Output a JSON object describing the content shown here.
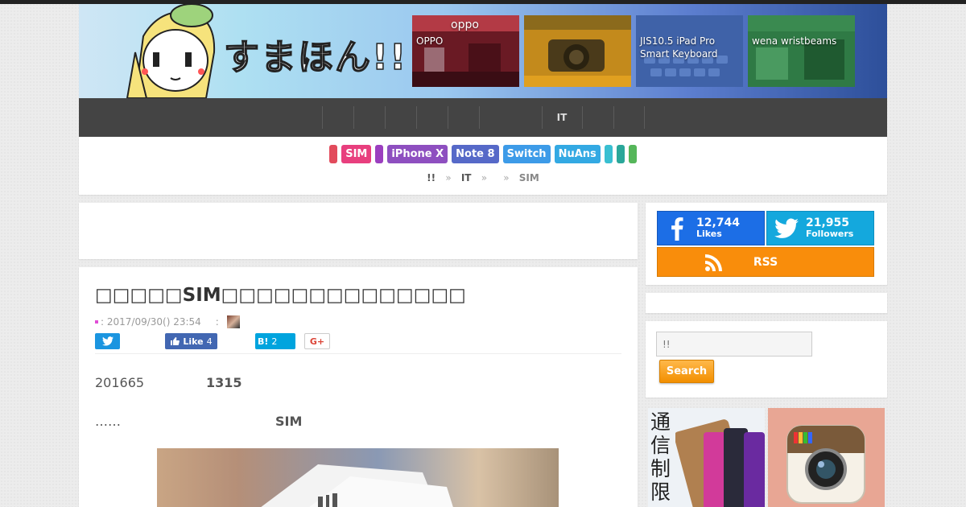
{
  "header": {
    "logo_text": "すまほん!!",
    "thumbnails": [
      {
        "label": "OPPO"
      },
      {
        "label": ""
      },
      {
        "label": "JIS10.5 iPad Pro Smart Keyboard"
      },
      {
        "label": "wena wristbeams"
      }
    ]
  },
  "nav": {
    "items": [
      "",
      "",
      "",
      "",
      "",
      "",
      "IT",
      "",
      ""
    ]
  },
  "tags": {
    "items": [
      {
        "label": "",
        "color": "#e24b5c"
      },
      {
        "label": "SIM",
        "color": "#e83f7e"
      },
      {
        "label": "",
        "color": "#9b3fbf"
      },
      {
        "label": "iPhone X",
        "color": "#8e4fc0"
      },
      {
        "label": "Note 8",
        "color": "#5669c8"
      },
      {
        "label": "Switch",
        "color": "#3d9be8"
      },
      {
        "label": "NuAns",
        "color": "#33a9e3"
      },
      {
        "label": "",
        "color": "#39bfd1"
      },
      {
        "label": "",
        "color": "#2aa79a"
      },
      {
        "label": "",
        "color": "#55b65a"
      }
    ]
  },
  "breadcrumb": {
    "home": "!!",
    "sep": "»",
    "it": "IT",
    "sim": "SIM"
  },
  "article": {
    "title": "SIM",
    "date": ": 2017/09/30() 23:54",
    "author_colon": ":",
    "share": {
      "facebook_like": "Like",
      "facebook_count": "4",
      "hatena_label": "B!",
      "hatena_count": "2",
      "google_label": "G+"
    },
    "para1_start": "201665",
    "para1_num": "1315",
    "para2_start": "……",
    "para2_sim": "SIM"
  },
  "sidebar": {
    "facebook": {
      "count": "12,744",
      "label": "Likes"
    },
    "twitter": {
      "count": "21,955",
      "label": "Followers"
    },
    "rss": {
      "label": "RSS"
    },
    "search": {
      "placeholder": "!!",
      "button": "Search"
    },
    "banner_text": "通信制限"
  }
}
